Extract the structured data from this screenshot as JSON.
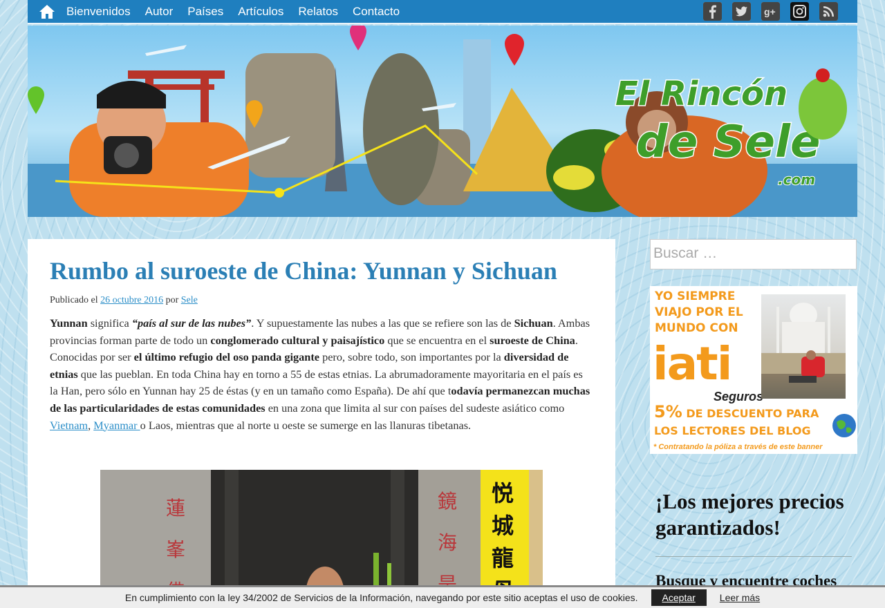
{
  "nav": {
    "items": [
      "Bienvenidos",
      "Autor",
      "Países",
      "Artículos",
      "Relatos",
      "Contacto"
    ],
    "social": [
      "f",
      "t",
      "g+",
      "ig",
      "rss"
    ]
  },
  "banner": {
    "logo_line1": "El Rincón",
    "logo_line2": "de Sele",
    "logo_line3": ".com"
  },
  "post": {
    "title": "Rumbo al suroeste de China: Yunnan y Sichuan",
    "meta_prefix": "Publicado el",
    "date": "26 octubre 2016",
    "meta_by": "por",
    "author": "Sele",
    "p": [
      "Yunnan",
      " significa ",
      "“país al sur de las nubes”",
      ". Y supuestamente las nubes a las que se refiere son las de ",
      "Sichuan",
      ". Ambas provincias forman parte de todo un ",
      "conglomerado cultural y paisajístico",
      " que se encuentra en el ",
      "suroeste de China",
      ". Conocidas por ser ",
      "el último refugio del oso panda gigante",
      " pero, sobre todo, son importantes por la ",
      "diversidad de etnias",
      " que las pueblan. En toda China hay en torno a 55 de estas etnias. La abrumadoramente mayoritaria en el país es la Han, pero sólo en Yunnan hay 25 de éstas (y en un tamaño como España). De ahí que t",
      "odavía permanezcan muchas de las particularidades de estas comunidades",
      " en una zona que limita al sur con países del sudeste asiático como ",
      "Vietnam",
      ", ",
      "Myanmar ",
      "o Laos, mientras que al norte u oeste se sumerge en las llanuras tibetanas."
    ]
  },
  "photo": {
    "left_chars": [
      "蓮",
      "峯",
      "佛"
    ],
    "mid_chars": [
      "鏡",
      "海",
      "是"
    ],
    "sign_chars": [
      "悦",
      "城",
      "龍",
      "母"
    ]
  },
  "sidebar": {
    "search_placeholder": "Buscar …",
    "ad": {
      "line1": "YO SIEMPRE VIAJO POR EL MUNDO CON",
      "brand": "iati",
      "brand_sub": "Seguros",
      "discount_big": "5%",
      "discount_rest": " DE DESCUENTO PARA LOS LECTORES DEL BLOG",
      "note": "* Contratando la póliza a través de este banner"
    },
    "widget_title": "¡Los mejores precios garantizados!",
    "widget_sub": "Busque y encuentre coches"
  },
  "cookie": {
    "text": "En cumplimiento con la ley 34/2002 de Servicios de la Información, navegando por este sitio aceptas el uso de cookies.",
    "accept": "Aceptar",
    "more": "Leer más"
  },
  "colors": {
    "nav_bg": "#1f7fbf",
    "title": "#2b7fb5",
    "link": "#2b8ec8",
    "ad_orange": "#f39a1c"
  }
}
